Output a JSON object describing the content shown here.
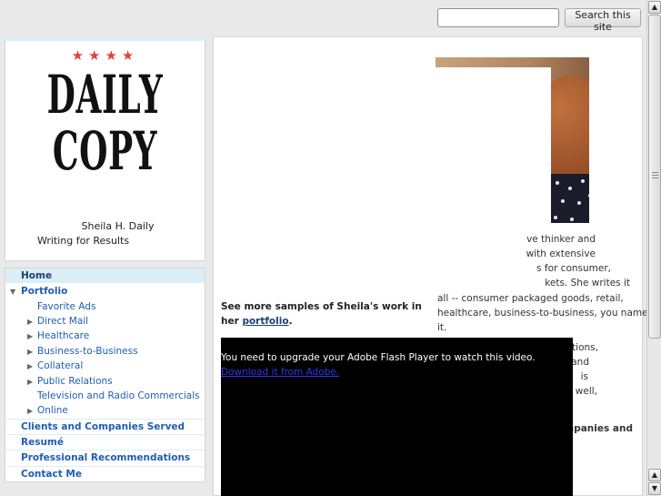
{
  "search": {
    "placeholder": "",
    "button_label": "Search this site"
  },
  "header": {
    "stars": "★★★★",
    "logo_line1": "DAILY",
    "logo_line2": "COPY",
    "name": "Sheila H. Daily",
    "tagline": "Writing for Results"
  },
  "nav": {
    "home": "Home",
    "portfolio": "Portfolio",
    "portfolio_items": [
      "Favorite Ads",
      "Direct Mail",
      "Healthcare",
      "Business-to-Business",
      "Collateral",
      "Public Relations",
      "Television and Radio Commercials",
      "Online"
    ],
    "clients": "Clients and Companies Served",
    "resume": "Resumé",
    "recommendations": "Professional Recommendations",
    "contact": "Contact Me"
  },
  "main": {
    "bio_fragments": [
      "ve thinker and",
      "with extensive",
      "s for consumer,",
      "kets. She writes it"
    ],
    "bio_lines": [
      "all -- consumer packaged goods, retail,",
      "healthcare, business-to-business, you name",
      "it."
    ],
    "bio_fragments_2": [
      "stions,",
      "and",
      "is",
      "d well,"
    ],
    "bio_bold_fragment": "mpanies and",
    "see_more_text": "See more samples of Sheila's work in her",
    "see_more_link": "portfolio",
    "see_more_end": ".",
    "flash_message": "You need to upgrade your Adobe Flash Player to watch this video.",
    "flash_link": "Download it from Adobe."
  },
  "colors": {
    "accent_blue": "#1f5db5",
    "nav_highlight": "#dbeef7",
    "stars_red": "#e0433a"
  }
}
